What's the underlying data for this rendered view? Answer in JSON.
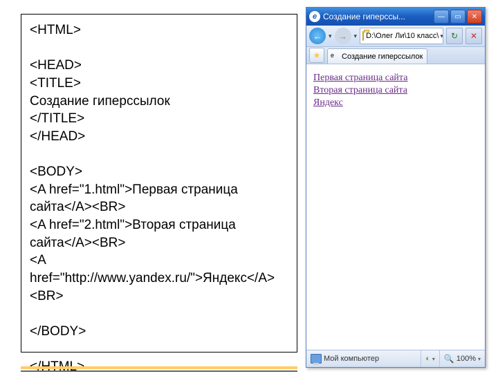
{
  "code": {
    "l1": "<HTML>",
    "l2": "<HEAD>",
    "l3": "<TITLE>",
    "l4": "Создание гиперссылок",
    "l5": "</TITLE>",
    "l6": "</HEAD>",
    "l7": "<BODY>",
    "l8": "<A href=\"1.html\">Первая страница сайта</A><BR>",
    "l9": "<A href=\"2.html\">Вторая страница сайта</A><BR>",
    "l10": "<A href=\"http://www.yandex.ru/\">Яндекс</A><BR>",
    "l11": "</BODY>",
    "l12": "</HTML>"
  },
  "browser": {
    "title": "Создание гиперссы...",
    "address": "D:\\Олег Ли\\10 класс\\",
    "tab": "Создание гиперссылок",
    "links": {
      "a": "Первая страница сайта",
      "b": "Вторая страница сайта",
      "c": "Яндекс"
    },
    "status": "Мой компьютер",
    "zoom": "100%"
  }
}
